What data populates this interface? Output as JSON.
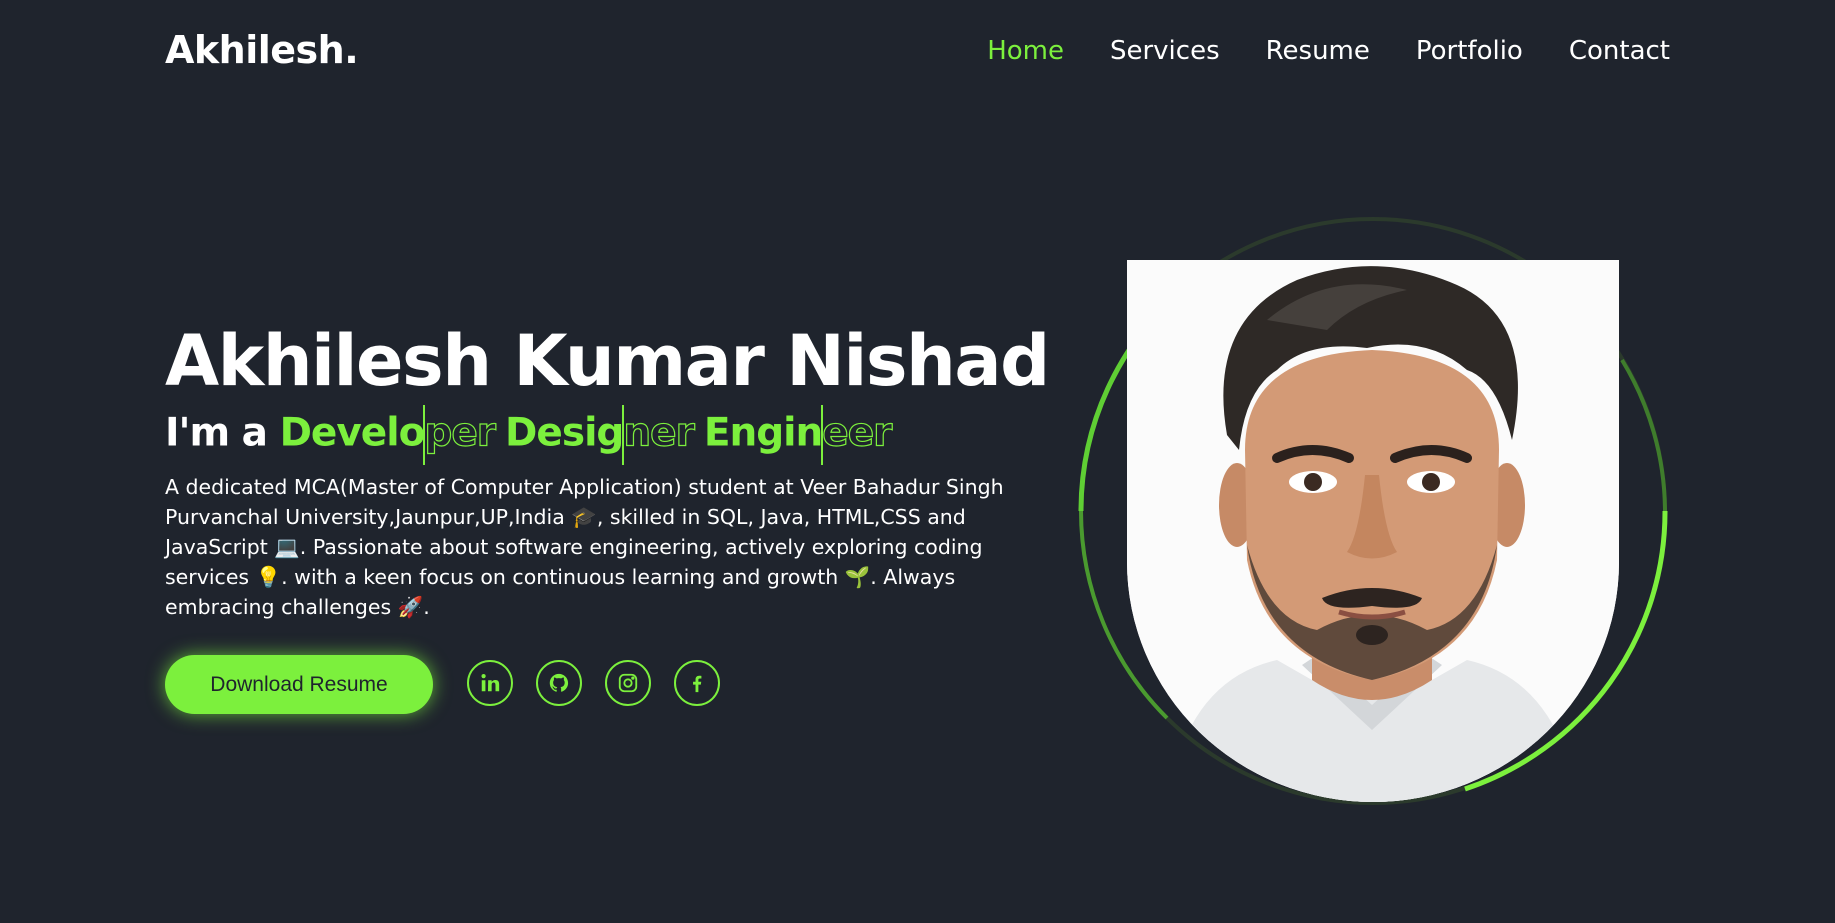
{
  "header": {
    "logo": "Akhilesh.",
    "nav": [
      "Home",
      "Services",
      "Resume",
      "Portfolio",
      "Contact"
    ],
    "active_nav": "Home"
  },
  "hero": {
    "name": "Akhilesh Kumar Nishad",
    "intro": "I'm a",
    "roles": [
      {
        "typed": "Develo",
        "rest": "per"
      },
      {
        "typed": "Desig",
        "rest": "ner"
      },
      {
        "typed": "Engin",
        "rest": "eer"
      }
    ],
    "description": "A dedicated MCA(Master of Computer Application) student at Veer Bahadur Singh Purvanchal University,Jaunpur,UP,India 🎓, skilled in SQL, Java, HTML,CSS and JavaScript 💻. Passionate about software engineering, actively exploring coding services 💡. with a keen focus on continuous learning and growth 🌱. Always embracing challenges 🚀.",
    "download_button": "Download Resume",
    "socials": [
      "linkedin-icon",
      "github-icon",
      "instagram-icon",
      "facebook-icon"
    ]
  },
  "colors": {
    "background": "#1f242d",
    "accent": "#7cf03d",
    "text": "#ffffff"
  }
}
